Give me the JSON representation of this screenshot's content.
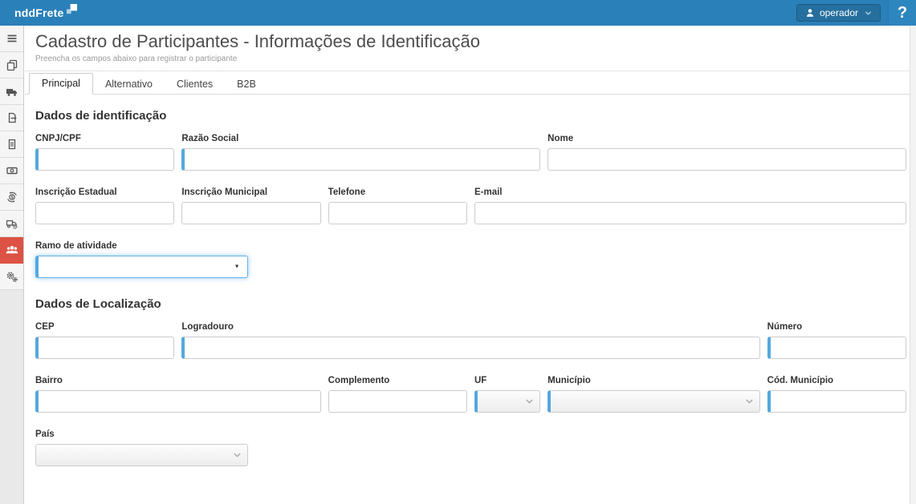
{
  "colors": {
    "header_bg": "#2A80B9",
    "user_box_bg": "#256F9E",
    "help_box_bg": "#2E86BF",
    "active_item_bg": "#DC5244",
    "required_bar": "#55A8DD",
    "focus_ring": "#66AFE9"
  },
  "topbar": {
    "logo": "nddFrete",
    "user_label": "operador",
    "help_label": "?"
  },
  "header": {
    "title": "Cadastro de Participantes - Informações de Identificação",
    "subtitle": "Preencha os campos abaixo para registrar o participante"
  },
  "tabs": [
    {
      "label": "Principal",
      "active": true
    },
    {
      "label": "Alternativo",
      "active": false
    },
    {
      "label": "Clientes",
      "active": false
    },
    {
      "label": "B2B",
      "active": false
    }
  ],
  "sidebar": {
    "items": [
      {
        "name": "menu",
        "icon": "menu",
        "active": false
      },
      {
        "name": "documents",
        "icon": "copy",
        "active": false
      },
      {
        "name": "freight",
        "icon": "truck",
        "active": false
      },
      {
        "name": "export",
        "icon": "export",
        "active": false
      },
      {
        "name": "document",
        "icon": "document",
        "active": false
      },
      {
        "name": "money",
        "icon": "money",
        "active": false
      },
      {
        "name": "payments",
        "icon": "money-sync",
        "active": false
      },
      {
        "name": "fleet",
        "icon": "truck-gear",
        "active": false
      },
      {
        "name": "participants",
        "icon": "users",
        "active": true
      },
      {
        "name": "settings",
        "icon": "gears",
        "active": false
      }
    ]
  },
  "form": {
    "sections": [
      {
        "heading": "Dados de identificação",
        "rows": [
          [
            {
              "name": "cnpj-cpf",
              "label": "CNPJ/CPF",
              "span": 2,
              "required": true,
              "type": "text",
              "value": ""
            },
            {
              "name": "razao-social",
              "label": "Razão Social",
              "span": 5,
              "required": true,
              "type": "text",
              "value": ""
            },
            {
              "name": "nome",
              "label": "Nome",
              "span": 5,
              "required": false,
              "type": "text",
              "value": ""
            }
          ],
          [
            {
              "name": "inscricao-estadual",
              "label": "Inscrição Estadual",
              "span": 2,
              "required": false,
              "type": "text",
              "value": ""
            },
            {
              "name": "inscricao-municipal",
              "label": "Inscrição Municipal",
              "span": 2,
              "required": false,
              "type": "text",
              "value": ""
            },
            {
              "name": "telefone",
              "label": "Telefone",
              "span": 2,
              "required": false,
              "type": "text",
              "value": ""
            },
            {
              "name": "email",
              "label": "E-mail",
              "span": 6,
              "required": false,
              "type": "text",
              "value": ""
            }
          ],
          [
            {
              "name": "ramo-de-atividade",
              "label": "Ramo de atividade",
              "span": 3,
              "required": true,
              "type": "select-native",
              "focused": true,
              "value": ""
            }
          ]
        ]
      },
      {
        "heading": "Dados de Localização",
        "rows": [
          [
            {
              "name": "cep",
              "label": "CEP",
              "span": 2,
              "required": true,
              "type": "text",
              "value": ""
            },
            {
              "name": "logradouro",
              "label": "Logradouro",
              "span": 8,
              "required": true,
              "type": "text",
              "value": ""
            },
            {
              "name": "numero",
              "label": "Número",
              "span": 2,
              "required": true,
              "type": "text",
              "value": ""
            }
          ],
          [
            {
              "name": "bairro",
              "label": "Bairro",
              "span": 4,
              "required": true,
              "type": "text",
              "value": ""
            },
            {
              "name": "complemento",
              "label": "Complemento",
              "span": 2,
              "required": false,
              "type": "text",
              "value": ""
            },
            {
              "name": "uf",
              "label": "UF",
              "span": 1,
              "required": true,
              "type": "select",
              "value": ""
            },
            {
              "name": "municipio",
              "label": "Município",
              "span": 3,
              "required": true,
              "type": "select",
              "value": ""
            },
            {
              "name": "cod-municipio",
              "label": "Cód. Município",
              "span": 2,
              "required": true,
              "type": "text",
              "value": ""
            }
          ],
          [
            {
              "name": "pais",
              "label": "País",
              "span": 3,
              "required": false,
              "type": "select",
              "value": ""
            }
          ]
        ]
      }
    ]
  }
}
